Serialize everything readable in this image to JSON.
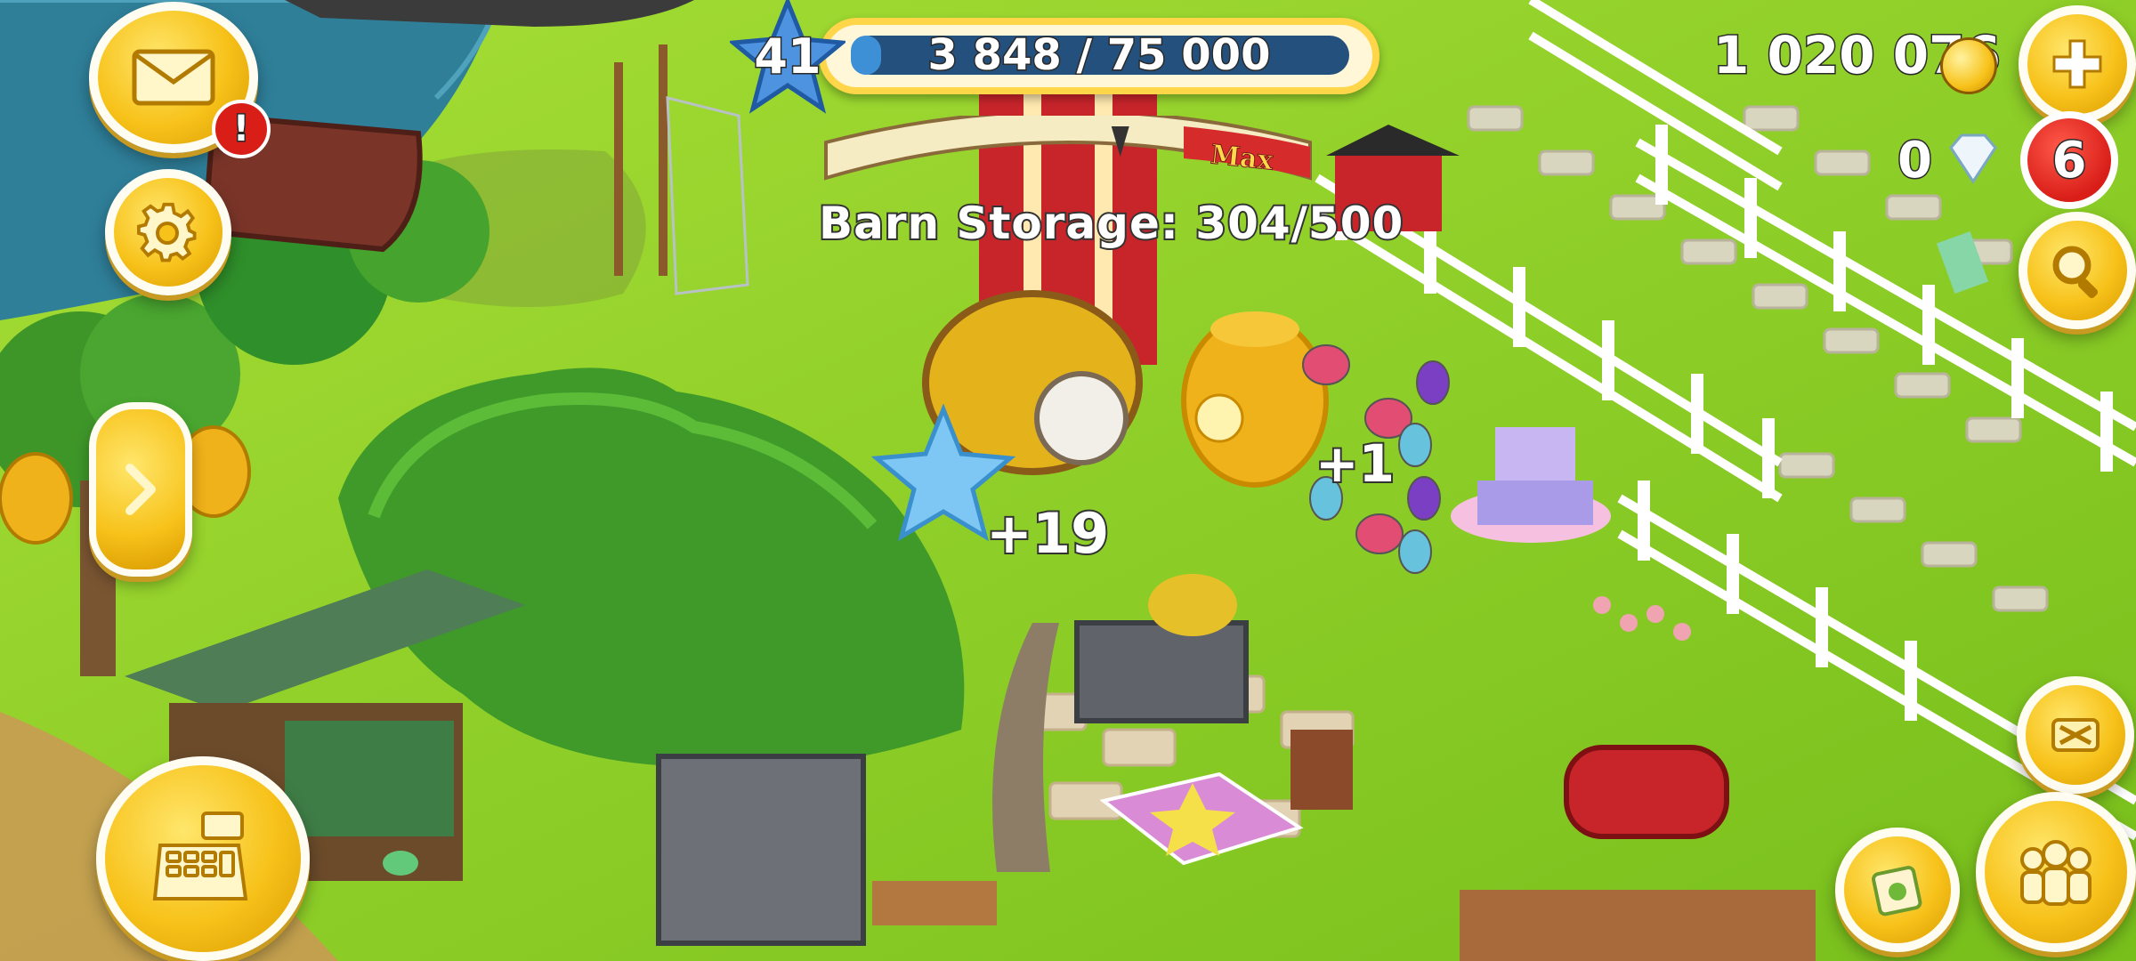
{
  "hud": {
    "level": "41",
    "xp_text": "3 848 / 75 000",
    "xp_fraction": 0.0513,
    "coins": "1 020 076",
    "diamonds": "0",
    "notifications": "6",
    "mail_alert": "!"
  },
  "barn": {
    "label": "Barn Storage: 304/500",
    "max_label": "Max",
    "fill_fraction": 0.608
  },
  "floaters": {
    "xp_gain": "+19",
    "honey_gain": "+1"
  },
  "icons": {
    "mail": "mail-icon",
    "settings": "gear-icon",
    "expand": "chevron-right-icon",
    "shop": "cash-register-icon",
    "add_coins": "plus-icon",
    "search": "magnifier-icon",
    "edit": "move-arrows-icon",
    "friends": "friends-icon",
    "orders": "order-board-icon"
  },
  "colors": {
    "grass": "#8fcf2a",
    "water": "#2f7f99",
    "button_gold": "#f7c21a",
    "notification_red": "#d91e18",
    "xp_bar_blue": "#3d8fd6"
  }
}
